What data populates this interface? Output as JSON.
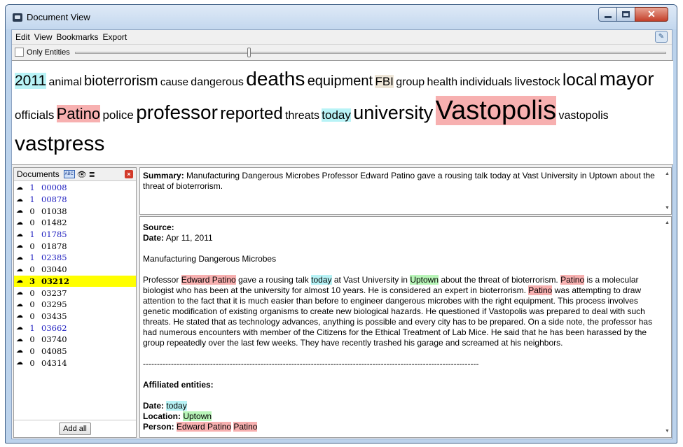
{
  "window": {
    "title": "Document View"
  },
  "menu": {
    "items": [
      "Edit",
      "View",
      "Bookmarks",
      "Export"
    ]
  },
  "options": {
    "only_entities_label": "Only Entities",
    "only_entities_checked": false
  },
  "cloud": {
    "words": [
      {
        "text": "2011",
        "size": 21,
        "hl": "blue"
      },
      {
        "text": "animal",
        "size": 16,
        "hl": ""
      },
      {
        "text": "bioterrorism",
        "size": 20,
        "hl": ""
      },
      {
        "text": "cause",
        "size": 15,
        "hl": ""
      },
      {
        "text": "dangerous",
        "size": 16,
        "hl": ""
      },
      {
        "text": "deaths",
        "size": 28,
        "hl": ""
      },
      {
        "text": "equipment",
        "size": 20,
        "hl": ""
      },
      {
        "text": "FBI",
        "size": 17,
        "hl": "tan"
      },
      {
        "text": "group",
        "size": 16,
        "hl": ""
      },
      {
        "text": "health",
        "size": 16,
        "hl": ""
      },
      {
        "text": "individuals",
        "size": 16,
        "hl": ""
      },
      {
        "text": "livestock",
        "size": 17,
        "hl": ""
      },
      {
        "text": "local",
        "size": 24,
        "hl": ""
      },
      {
        "text": "mayor",
        "size": 28,
        "hl": ""
      },
      {
        "text": "officials",
        "size": 17,
        "hl": ""
      },
      {
        "text": "Patino",
        "size": 22,
        "hl": "pink"
      },
      {
        "text": "police",
        "size": 17,
        "hl": ""
      },
      {
        "text": "professor",
        "size": 28,
        "hl": ""
      },
      {
        "text": "reported",
        "size": 24,
        "hl": ""
      },
      {
        "text": "threats",
        "size": 16,
        "hl": ""
      },
      {
        "text": "today",
        "size": 17,
        "hl": "blue"
      },
      {
        "text": "university",
        "size": 27,
        "hl": ""
      },
      {
        "text": "Vastopolis",
        "size": 38,
        "hl": "pink"
      },
      {
        "text": "vastopolis",
        "size": 16,
        "hl": ""
      },
      {
        "text": "vastpress",
        "size": 30,
        "hl": ""
      }
    ]
  },
  "documents": {
    "title": "Documents",
    "add_all_label": "Add all",
    "rows": [
      {
        "count": "1",
        "id": "00008",
        "linked": true,
        "selected": false
      },
      {
        "count": "1",
        "id": "00878",
        "linked": true,
        "selected": false
      },
      {
        "count": "0",
        "id": "01038",
        "linked": false,
        "selected": false
      },
      {
        "count": "0",
        "id": "01482",
        "linked": false,
        "selected": false
      },
      {
        "count": "1",
        "id": "01785",
        "linked": true,
        "selected": false
      },
      {
        "count": "0",
        "id": "01878",
        "linked": false,
        "selected": false
      },
      {
        "count": "1",
        "id": "02385",
        "linked": true,
        "selected": false
      },
      {
        "count": "0",
        "id": "03040",
        "linked": false,
        "selected": false
      },
      {
        "count": "3",
        "id": "03212",
        "linked": false,
        "selected": true
      },
      {
        "count": "0",
        "id": "03237",
        "linked": false,
        "selected": false
      },
      {
        "count": "0",
        "id": "03295",
        "linked": false,
        "selected": false
      },
      {
        "count": "0",
        "id": "03435",
        "linked": false,
        "selected": false
      },
      {
        "count": "1",
        "id": "03662",
        "linked": true,
        "selected": false
      },
      {
        "count": "0",
        "id": "03740",
        "linked": false,
        "selected": false
      },
      {
        "count": "0",
        "id": "04085",
        "linked": false,
        "selected": false
      },
      {
        "count": "0",
        "id": "04314",
        "linked": false,
        "selected": false
      }
    ]
  },
  "summary": {
    "label": "Summary:",
    "text": "Manufacturing Dangerous Microbes Professor Edward Patino gave a rousing talk today at Vast University in Uptown about the threat of bioterrorism."
  },
  "doc": {
    "source_label": "Source:",
    "date_label": "Date:",
    "date_value": "Apr 11, 2011",
    "headline": "Manufacturing Dangerous Microbes",
    "body": {
      "t1": "Professor ",
      "e1": "Edward Patino",
      "t2": " gave a rousing talk ",
      "e2": "today",
      "t3": " at Vast University in ",
      "e3": "Uptown",
      "t4": " about the threat of bioterrorism. ",
      "e4": "Patino",
      "t5": " is a molecular biologist who has been at the university for almost 10 years. He is considered an expert in bioterrorism. ",
      "e5": "Patino",
      "t6": " was attempting to draw attention to the fact that it is much easier than before to engineer dangerous microbes with the right equipment. This process involves genetic modification of existing organisms to create new biological hazards. He questioned if Vastopolis was prepared to deal with such threats. He stated that as technology advances, anything is possible and every city has to be prepared. On a side note, the professor has had numerous encounters with member of the Citizens for the Ethical Treatment of Lab Mice. He said that he has been harassed by the group repeatedly over the last few weeks. They have recently trashed his garage and screamed at his neighbors."
    },
    "separator": "------------------------------------------------------------------------------------------------------------------------",
    "affiliated_label": "Affiliated entities:",
    "aff_date_label": "Date:",
    "aff_date_value": "today",
    "aff_location_label": "Location:",
    "aff_location_value": "Uptown",
    "aff_person_label": "Person:",
    "aff_person_value1": "Edward Patino",
    "aff_person_value2": "Patino"
  },
  "colors": {
    "entity_time": "#b8f3f6",
    "entity_person": "#f7b0b0",
    "entity_location": "#b8f5b8",
    "entity_org": "#eee6d8",
    "selected_row": "#ffff00",
    "linked_doc": "#2020c0"
  },
  "icons": {
    "window": "app-icon",
    "menu_right": "bookmark-icon",
    "sort": "abc-sort-icon",
    "view": "eye-icon",
    "list": "list-icon",
    "close": "close-icon",
    "row": "cloud-icon"
  }
}
